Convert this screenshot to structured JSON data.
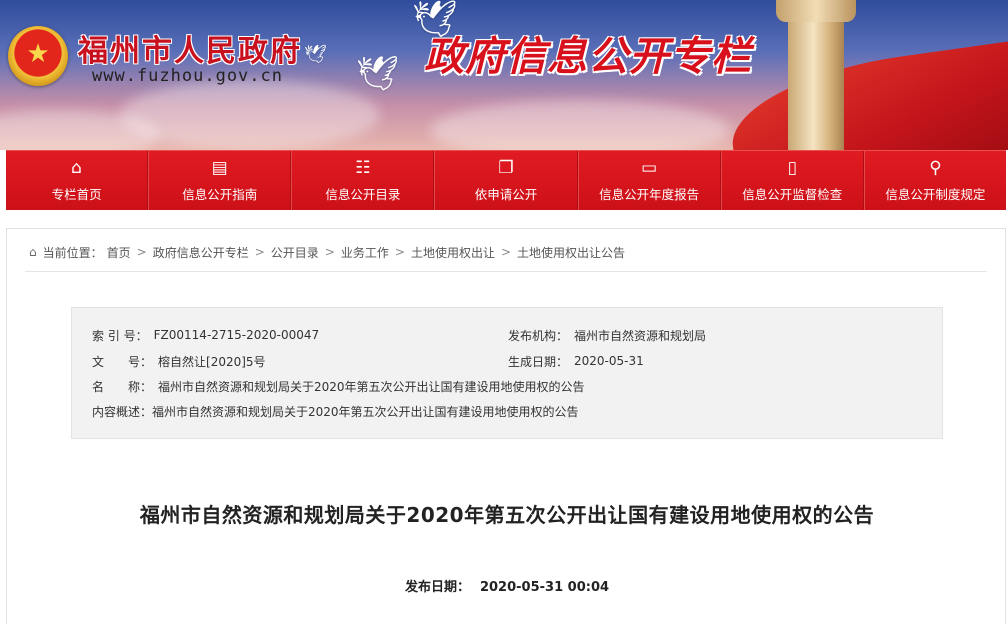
{
  "banner": {
    "site_name": "福州市人民政府",
    "site_url": "www.fuzhou.gov.cn",
    "section_title": "政府信息公开专栏"
  },
  "nav": {
    "items": [
      {
        "label": "专栏首页",
        "icon": "home-icon",
        "glyph": "⌂"
      },
      {
        "label": "信息公开指南",
        "icon": "guide-doc-icon",
        "glyph": "▤"
      },
      {
        "label": "信息公开目录",
        "icon": "catalog-icon",
        "glyph": "☷"
      },
      {
        "label": "依申请公开",
        "icon": "document-icon",
        "glyph": "❐"
      },
      {
        "label": "信息公开年度报告",
        "icon": "report-icon",
        "glyph": "▭"
      },
      {
        "label": "信息公开监督检查",
        "icon": "supervision-icon",
        "glyph": "▯"
      },
      {
        "label": "信息公开制度规定",
        "icon": "search-rule-icon",
        "glyph": "⚲"
      }
    ]
  },
  "breadcrumb": {
    "prefix": "当前位置：",
    "items": [
      "首页",
      "政府信息公开专栏",
      "公开目录",
      "业务工作",
      "土地使用权出让",
      "土地使用权出让公告"
    ]
  },
  "meta": {
    "index_label": "索 引 号：",
    "index_value": "FZ00114-2715-2020-00047",
    "publisher_label": "发布机构：",
    "publisher_value": "福州市自然资源和规划局",
    "docno_label": "文　　号：",
    "docno_value": "榕自然让[2020]5号",
    "gen_date_label": "生成日期：",
    "gen_date_value": "2020-05-31",
    "name_label": "名　　称：",
    "name_value": "福州市自然资源和规划局关于2020年第五次公开出让国有建设用地使用权的公告",
    "summary_label": "内容概述：",
    "summary_value": "福州市自然资源和规划局关于2020年第五次公开出让国有建设用地使用权的公告"
  },
  "article": {
    "title": "福州市自然资源和规划局关于2020年第五次公开出让国有建设用地使用权的公告",
    "pub_label": "发布日期：",
    "pub_value": "2020-05-31 00:04"
  },
  "colors": {
    "brand_red": "#d4121a",
    "title_red": "#c8101e"
  }
}
